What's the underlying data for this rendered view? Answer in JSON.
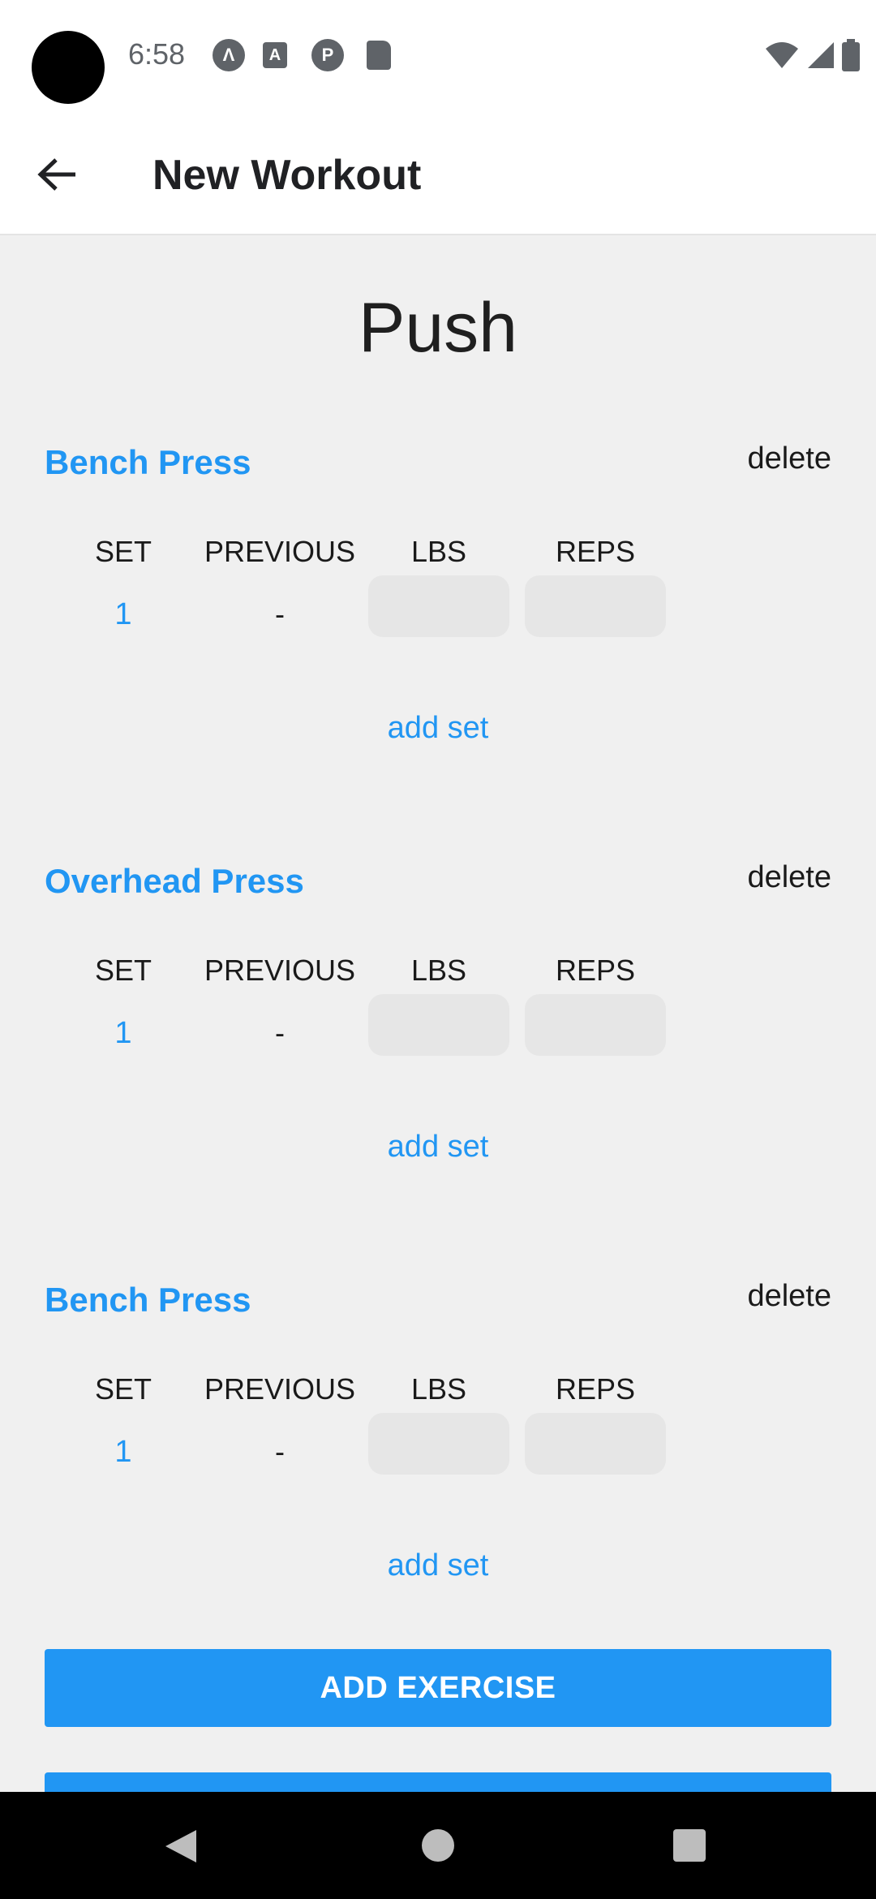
{
  "status_bar": {
    "time": "6:58",
    "icons": [
      "app-a-icon",
      "font-a-icon",
      "p-icon",
      "sd-card-icon"
    ],
    "right_icons": [
      "wifi-icon",
      "signal-icon",
      "battery-icon"
    ]
  },
  "app_bar": {
    "title": "New Workout",
    "back_icon": "arrow-back-icon"
  },
  "workout": {
    "name": "Push",
    "columns": {
      "set": "SET",
      "previous": "PREVIOUS",
      "lbs": "LBS",
      "reps": "REPS"
    },
    "exercises": [
      {
        "name": "Bench Press",
        "delete_label": "delete",
        "add_set_label": "add set",
        "sets": [
          {
            "set": "1",
            "previous": "-",
            "lbs": "",
            "reps": ""
          }
        ]
      },
      {
        "name": "Overhead Press",
        "delete_label": "delete",
        "add_set_label": "add set",
        "sets": [
          {
            "set": "1",
            "previous": "-",
            "lbs": "",
            "reps": ""
          }
        ]
      },
      {
        "name": "Bench Press",
        "delete_label": "delete",
        "add_set_label": "add set",
        "sets": [
          {
            "set": "1",
            "previous": "-",
            "lbs": "",
            "reps": ""
          }
        ]
      }
    ]
  },
  "actions": {
    "add_exercise": "ADD EXERCISE",
    "second_button": ""
  },
  "colors": {
    "accent": "#2196f3",
    "background": "#f0f0f0",
    "input_fill": "#e6e6e6"
  }
}
